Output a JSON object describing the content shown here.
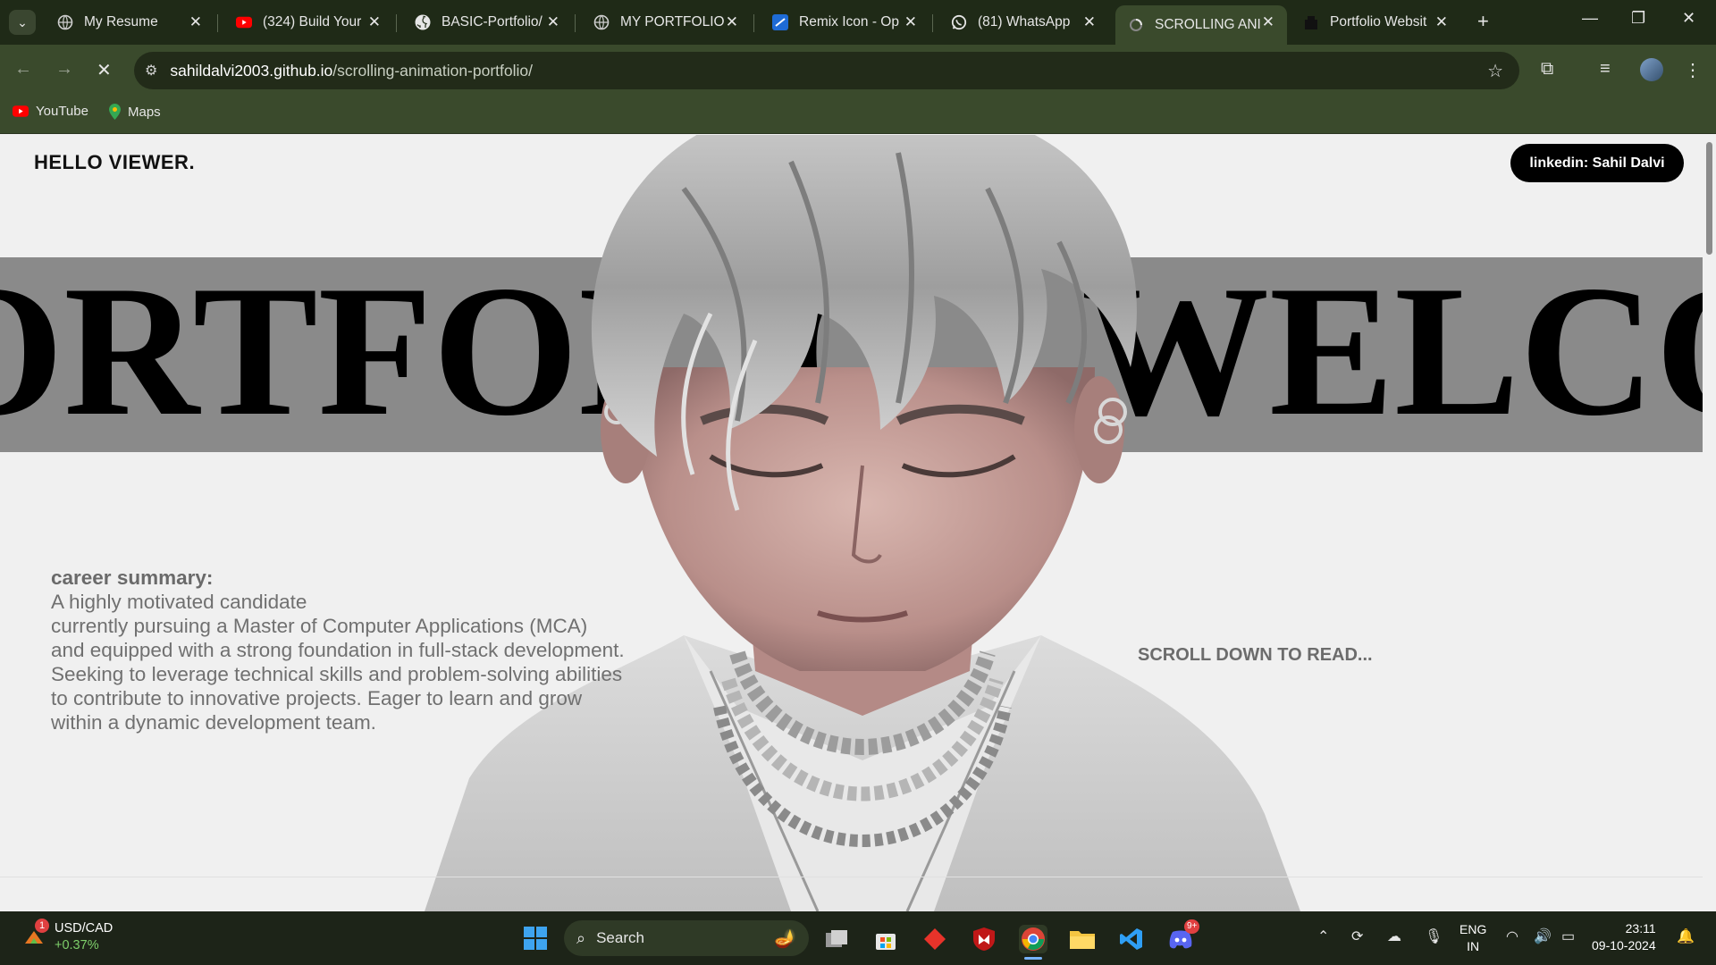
{
  "browser": {
    "tabs": [
      {
        "title": "My Resume",
        "icon": "globe-icon"
      },
      {
        "title": "(324) Build Your",
        "icon": "youtube-icon"
      },
      {
        "title": "BASIC-Portfolio/",
        "icon": "github-icon"
      },
      {
        "title": "MY PORTFOLIO",
        "icon": "globe-icon"
      },
      {
        "title": "Remix Icon - Op",
        "icon": "remix-icon"
      },
      {
        "title": "(81) WhatsApp",
        "icon": "whatsapp-icon"
      },
      {
        "title": "SCROLLING ANI",
        "icon": "loading-icon",
        "active": true
      },
      {
        "title": "Portfolio Websit",
        "icon": "figma-icon"
      }
    ],
    "url_host": "sahildalvi2003.github.io",
    "url_path": "/scrolling-animation-portfolio/",
    "bookmarks": [
      {
        "label": "YouTube",
        "icon": "youtube-icon"
      },
      {
        "label": "Maps",
        "icon": "maps-icon"
      }
    ],
    "accent": "#3a4a2c"
  },
  "page": {
    "hello": "HELLO VIEWER.",
    "linkedin_label": "linkedin: Sahil Dalvi",
    "marquee_left": "ORTFOLIO",
    "marquee_right": "WELCOME",
    "summary_heading": "career summary:",
    "summary_lines": [
      "A highly motivated candidate",
      "currently pursuing a Master of Computer Applications (MCA)",
      "and equipped with a strong foundation in full-stack development.",
      "Seeking to leverage technical skills and problem-solving abilities",
      "to contribute to innovative projects. Eager to learn and grow",
      "within a dynamic development team."
    ],
    "scroll_hint": "SCROLL DOWN TO READ..."
  },
  "taskbar": {
    "ticker_name": "USD/CAD",
    "ticker_change": "+0.37%",
    "ticker_badge": "1",
    "search_label": "Search",
    "lang_top": "ENG",
    "lang_bottom": "IN",
    "time": "23:11",
    "date": "09-10-2024",
    "discord_badge": "9+"
  }
}
